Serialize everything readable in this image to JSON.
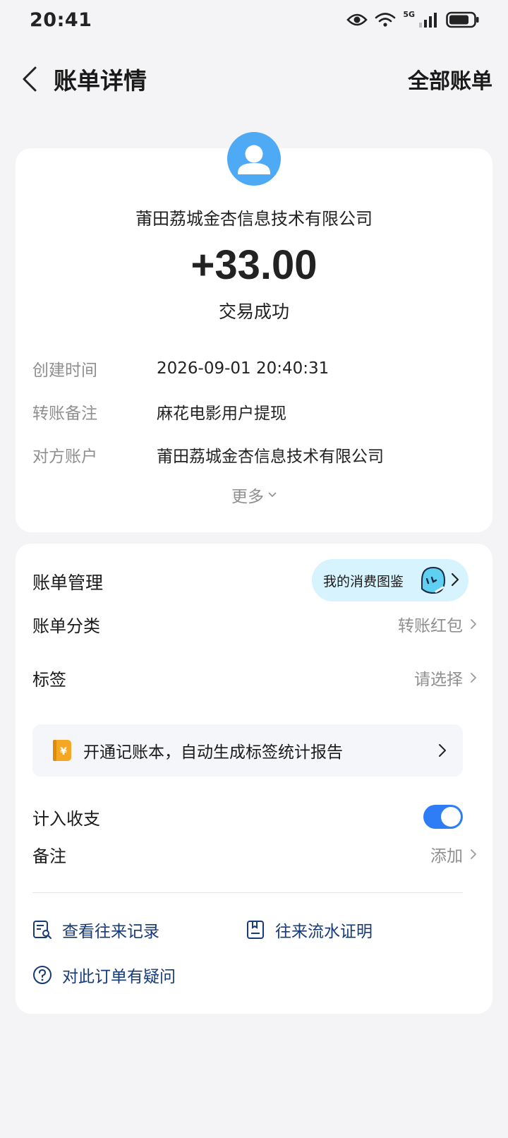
{
  "status_bar": {
    "time": "20:41",
    "network": "5G"
  },
  "header": {
    "title": "账单详情",
    "all_bills": "全部账单"
  },
  "summary": {
    "merchant": "莆田荔城金杏信息技术有限公司",
    "amount": "+33.00",
    "status": "交易成功"
  },
  "details": [
    {
      "label": "创建时间",
      "value": "2026-09-01 20:40:31"
    },
    {
      "label": "转账备注",
      "value": "麻花电影用户提现"
    },
    {
      "label": "对方账户",
      "value": "莆田荔城金杏信息技术有限公司"
    }
  ],
  "more_label": "更多",
  "management": {
    "title": "账单管理",
    "consume_pill": "我的消费图鉴",
    "category_label": "账单分类",
    "category_value": "转账红包",
    "tag_label": "标签",
    "tag_value": "请选择",
    "ledger_banner": "开通记账本，自动生成标签统计报告",
    "ledger_badge": "¥",
    "income_label": "计入收支",
    "income_enabled": true,
    "note_label": "备注",
    "note_value": "添加"
  },
  "links": {
    "records": "查看往来记录",
    "proof": "往来流水证明",
    "question": "对此订单有疑问"
  },
  "colors": {
    "accent_blue": "#2e7cf6",
    "avatar_blue": "#4faaf5",
    "pill_bg": "#d7f3fd",
    "link_navy": "#173a78",
    "badge_orange": "#f5a623"
  }
}
